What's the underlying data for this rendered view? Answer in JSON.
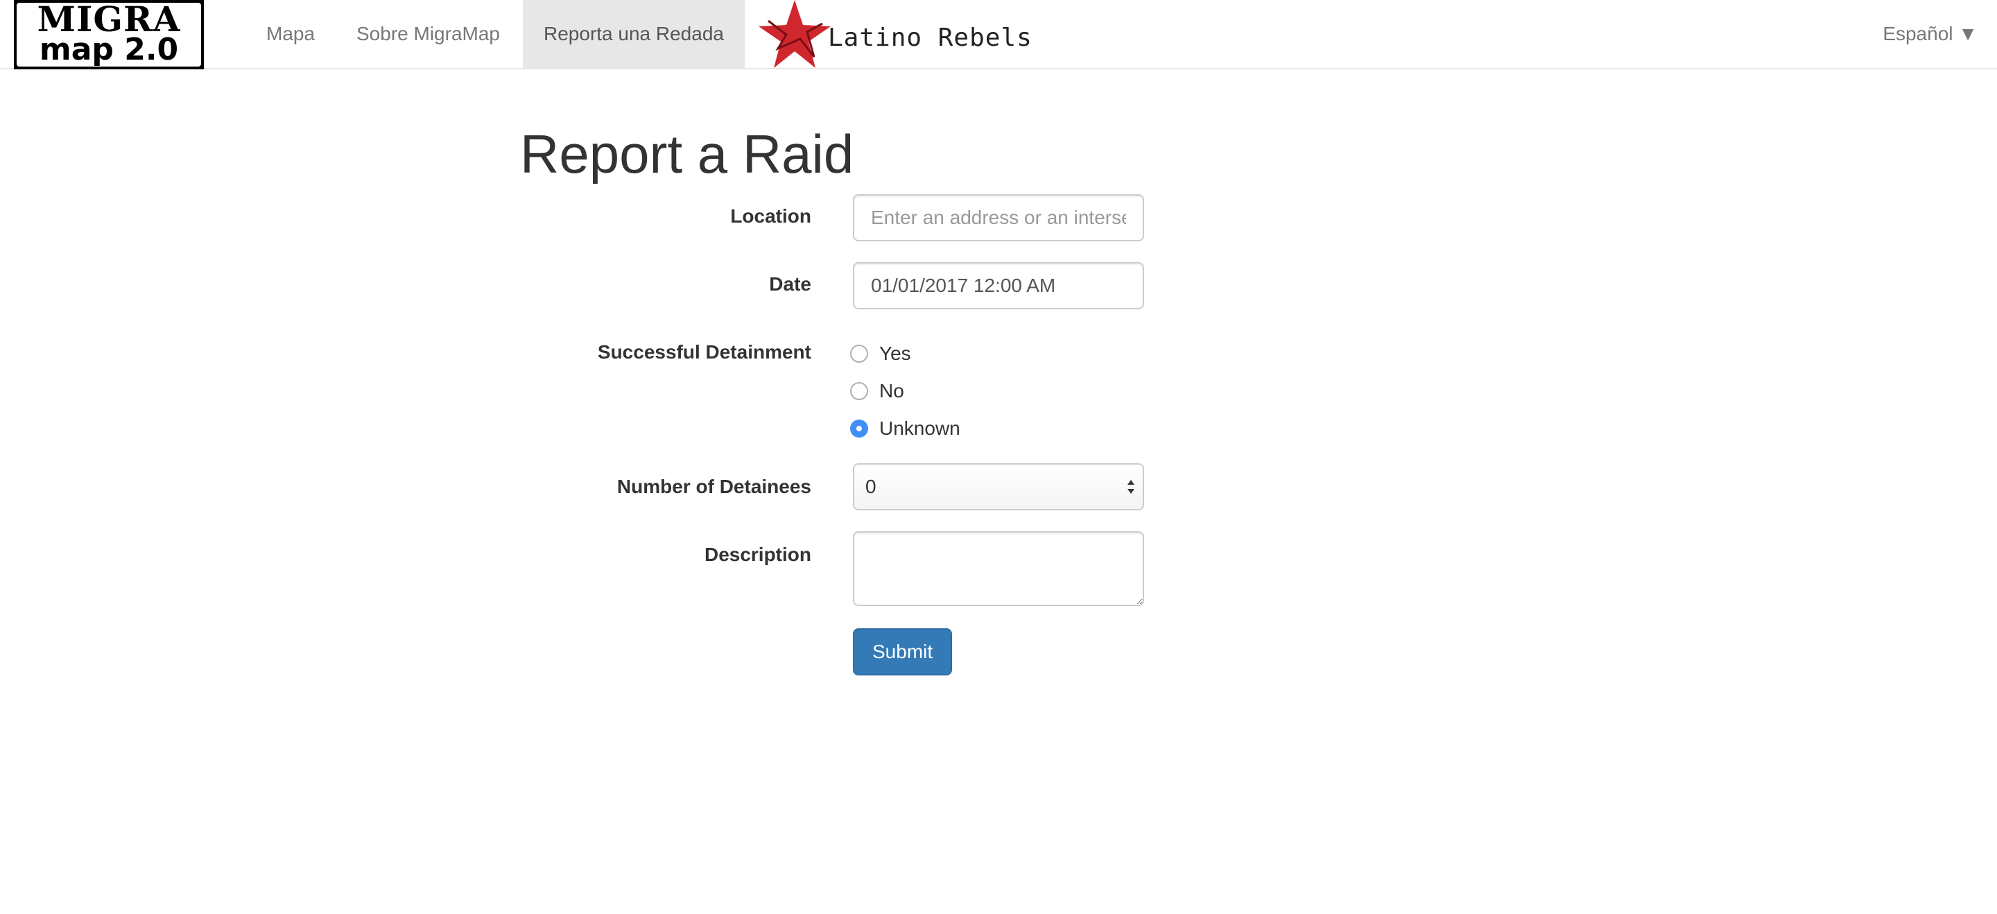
{
  "navbar": {
    "logo": {
      "line1": "MIGRA",
      "line2": "map 2.0"
    },
    "links": [
      {
        "label": "Mapa"
      },
      {
        "label": "Sobre MigraMap"
      },
      {
        "label": "Reporta una Redada",
        "active": true
      }
    ],
    "partner_logo_text": "Latino Rebels",
    "language": "Español ▼"
  },
  "form": {
    "title": "Report a Raid",
    "location": {
      "label": "Location",
      "placeholder": "Enter an address or an intersection",
      "value": ""
    },
    "date": {
      "label": "Date",
      "value": "01/01/2017 12:00 AM"
    },
    "detainment": {
      "label": "Successful Detainment",
      "options": [
        {
          "label": "Yes",
          "checked": false
        },
        {
          "label": "No",
          "checked": false
        },
        {
          "label": "Unknown",
          "checked": true
        }
      ]
    },
    "detainees": {
      "label": "Number of Detainees",
      "value": "0"
    },
    "description": {
      "label": "Description",
      "value": ""
    },
    "submit_label": "Submit"
  },
  "colors": {
    "primary": "#337ab7",
    "radio_checked": "#3f8ff7",
    "star_red": "#d0272f",
    "nav_active_bg": "#e7e7e7"
  }
}
